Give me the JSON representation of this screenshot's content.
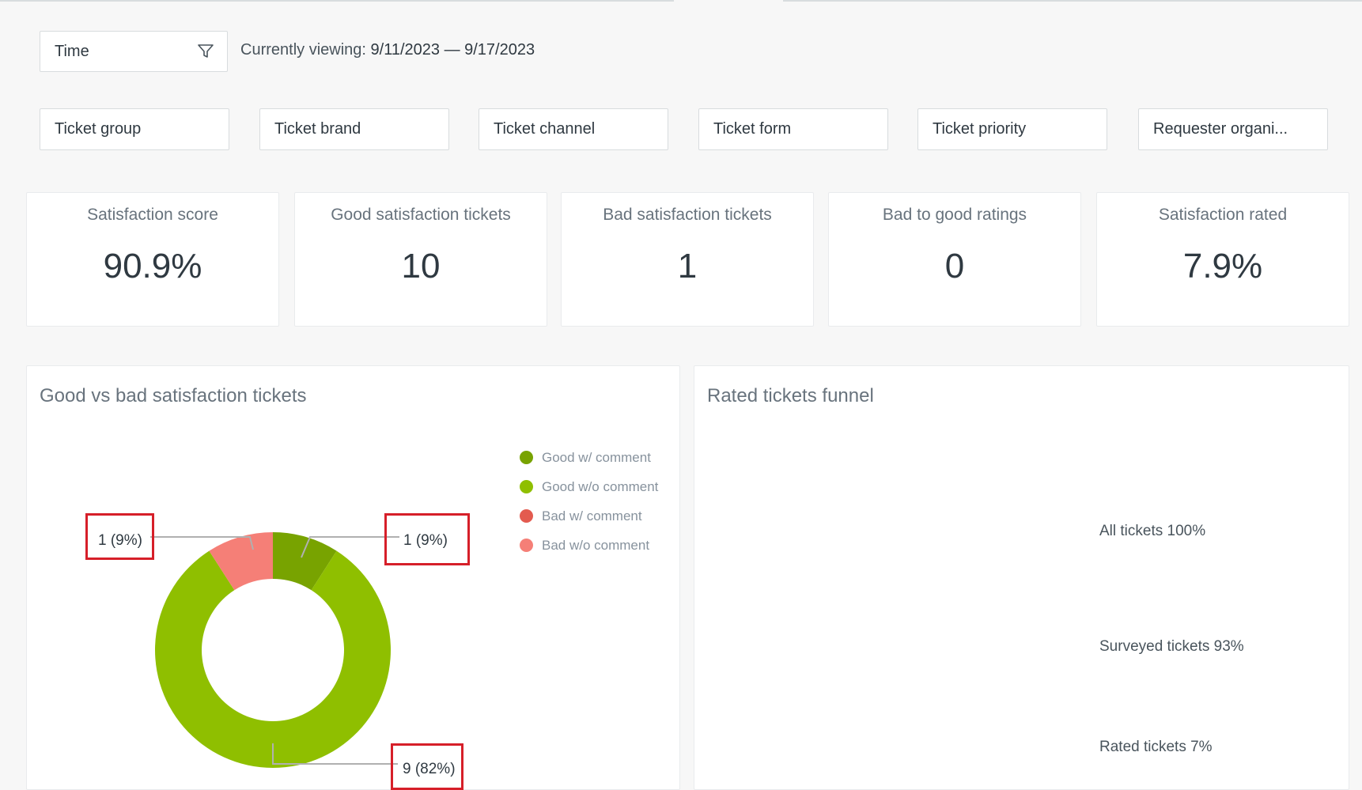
{
  "time_filter": {
    "label": "Time",
    "icon": "filter-icon"
  },
  "viewing": {
    "prefix": "Currently viewing:",
    "range": "9/11/2023 — 9/17/2023"
  },
  "filters": [
    "Ticket group",
    "Ticket brand",
    "Ticket channel",
    "Ticket form",
    "Ticket priority",
    "Requester organi..."
  ],
  "kpis": [
    {
      "label": "Satisfaction score",
      "value": "90.9%"
    },
    {
      "label": "Good satisfaction tickets",
      "value": "10"
    },
    {
      "label": "Bad satisfaction tickets",
      "value": "1"
    },
    {
      "label": "Bad to good ratings",
      "value": "0"
    },
    {
      "label": "Satisfaction rated",
      "value": "7.9%"
    }
  ],
  "donut": {
    "title": "Good vs bad satisfaction tickets",
    "legend": [
      {
        "label": "Good w/ comment",
        "color": "#78a300"
      },
      {
        "label": "Good w/o comment",
        "color": "#8fbf00"
      },
      {
        "label": "Bad w/ comment",
        "color": "#e35b4f"
      },
      {
        "label": "Bad w/o comment",
        "color": "#f57f77"
      }
    ],
    "callouts": {
      "left": "1 (9%)",
      "right": "1 (9%)",
      "bottom": "9 (82%)"
    }
  },
  "funnel": {
    "title": "Rated tickets funnel",
    "stages": [
      {
        "label": "All tickets 100%",
        "color": "#d9dcdd"
      },
      {
        "label": "Surveyed tickets 93%",
        "color": "#8cb0b4"
      },
      {
        "label": "Rated tickets 7%",
        "color": "#03535c"
      }
    ]
  },
  "chart_data": [
    {
      "type": "pie",
      "title": "Good vs bad satisfaction tickets",
      "categories": [
        "Good w/ comment",
        "Good w/o comment",
        "Bad w/ comment",
        "Bad w/o comment"
      ],
      "values": [
        1,
        9,
        0,
        1
      ],
      "data_labels": [
        "1 (9%)",
        "9 (82%)",
        "",
        "1 (9%)"
      ],
      "legend": "right"
    },
    {
      "type": "bar",
      "title": "Rated tickets funnel",
      "categories": [
        "All tickets",
        "Surveyed tickets",
        "Rated tickets"
      ],
      "values": [
        100,
        93,
        7
      ]
    }
  ]
}
